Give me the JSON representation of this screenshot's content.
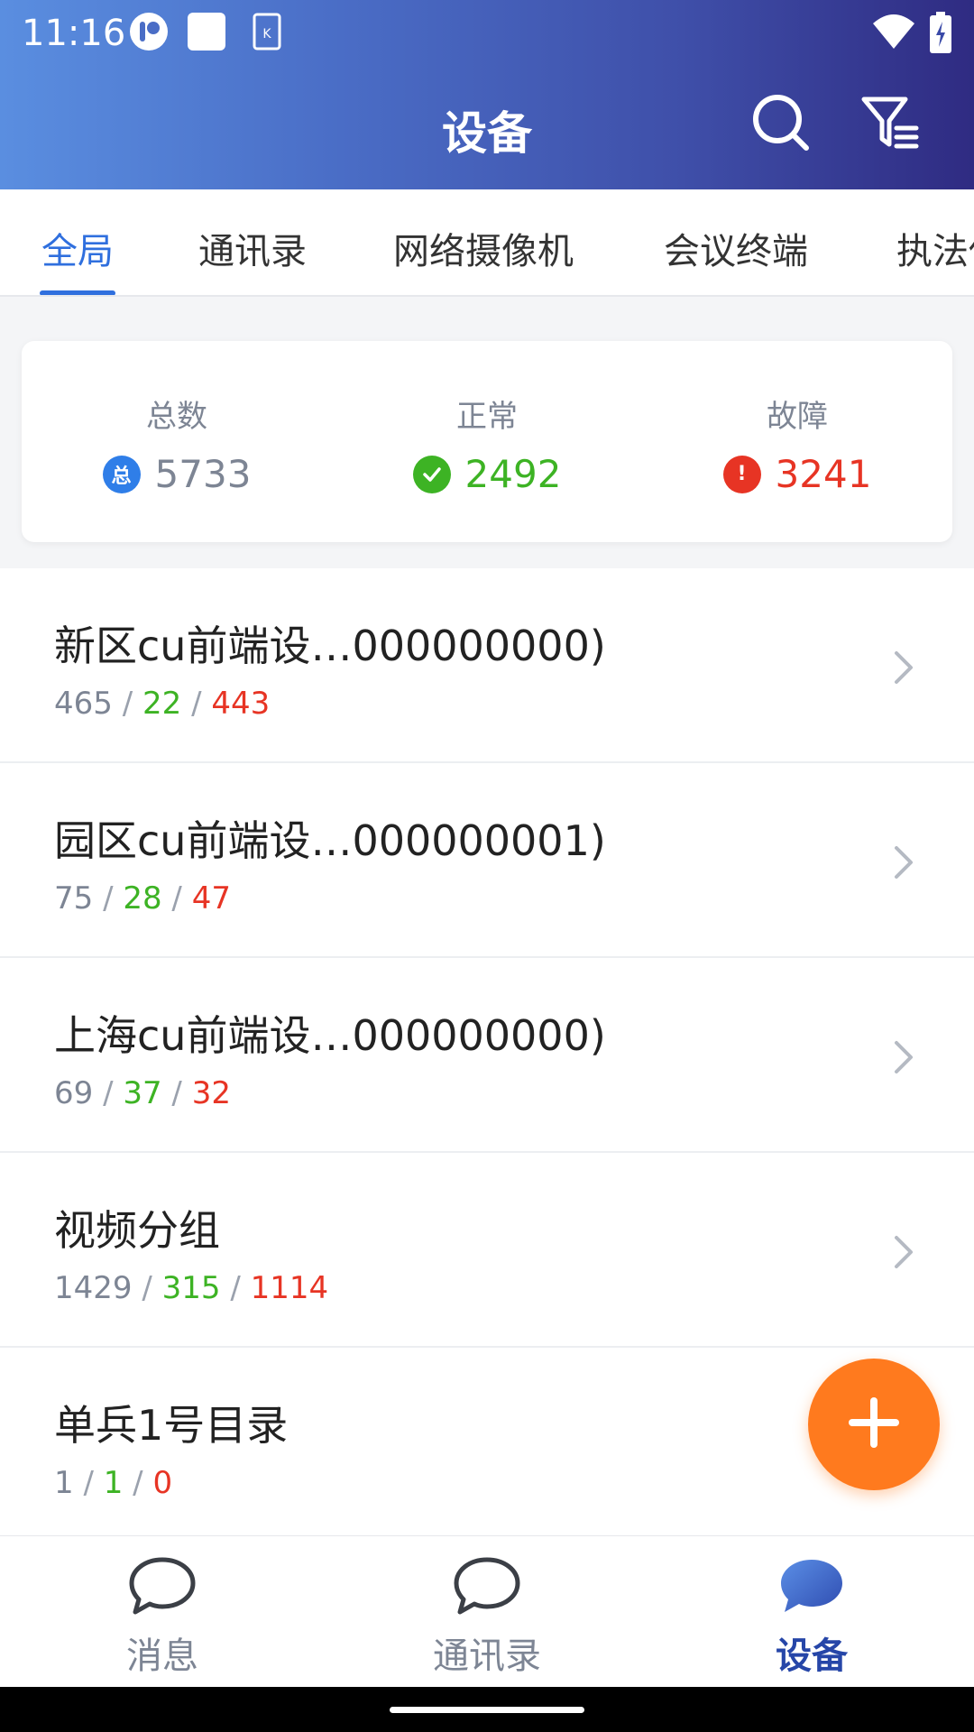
{
  "status_bar": {
    "time": "11:16",
    "icons": [
      "app-badge-icon",
      "square-notification-icon",
      "keyboard-notification-icon",
      "wifi-icon",
      "battery-charging-icon"
    ]
  },
  "nav": {
    "title": "设备",
    "search_icon": "search-icon",
    "filter_icon": "filter-list-icon"
  },
  "tabs": [
    {
      "label": "全局",
      "active": true
    },
    {
      "label": "通讯录",
      "active": false
    },
    {
      "label": "网络摄像机",
      "active": false
    },
    {
      "label": "会议终端",
      "active": false
    },
    {
      "label": "执法仪",
      "active": false
    }
  ],
  "summary": {
    "total": {
      "label": "总数",
      "icon_char": "总",
      "value": "5733"
    },
    "normal": {
      "label": "正常",
      "value": "2492"
    },
    "fault": {
      "label": "故障",
      "icon_char": "!",
      "value": "3241"
    }
  },
  "colors": {
    "accent": "#2f6fde",
    "ok": "#3db324",
    "fault": "#e73424",
    "fab": "#ff7a1e",
    "nav_active": "#2646a8"
  },
  "list": [
    {
      "title": "新区cu前端设…000000000)",
      "total": "465",
      "ok": "22",
      "bad": "443"
    },
    {
      "title": "园区cu前端设…000000001)",
      "total": "75",
      "ok": "28",
      "bad": "47"
    },
    {
      "title": "上海cu前端设…000000000)",
      "total": "69",
      "ok": "37",
      "bad": "32"
    },
    {
      "title": "视频分组",
      "total": "1429",
      "ok": "315",
      "bad": "1114"
    },
    {
      "title": "单兵1号目录",
      "total": "1",
      "ok": "1",
      "bad": "0"
    }
  ],
  "separator": "/",
  "fab": {
    "icon": "plus-icon"
  },
  "bottom_nav": [
    {
      "label": "消息",
      "icon": "chat-bubble-icon",
      "active": false
    },
    {
      "label": "通讯录",
      "icon": "chat-bubble-icon",
      "active": false
    },
    {
      "label": "设备",
      "icon": "chat-bubble-filled-icon",
      "active": true
    }
  ]
}
